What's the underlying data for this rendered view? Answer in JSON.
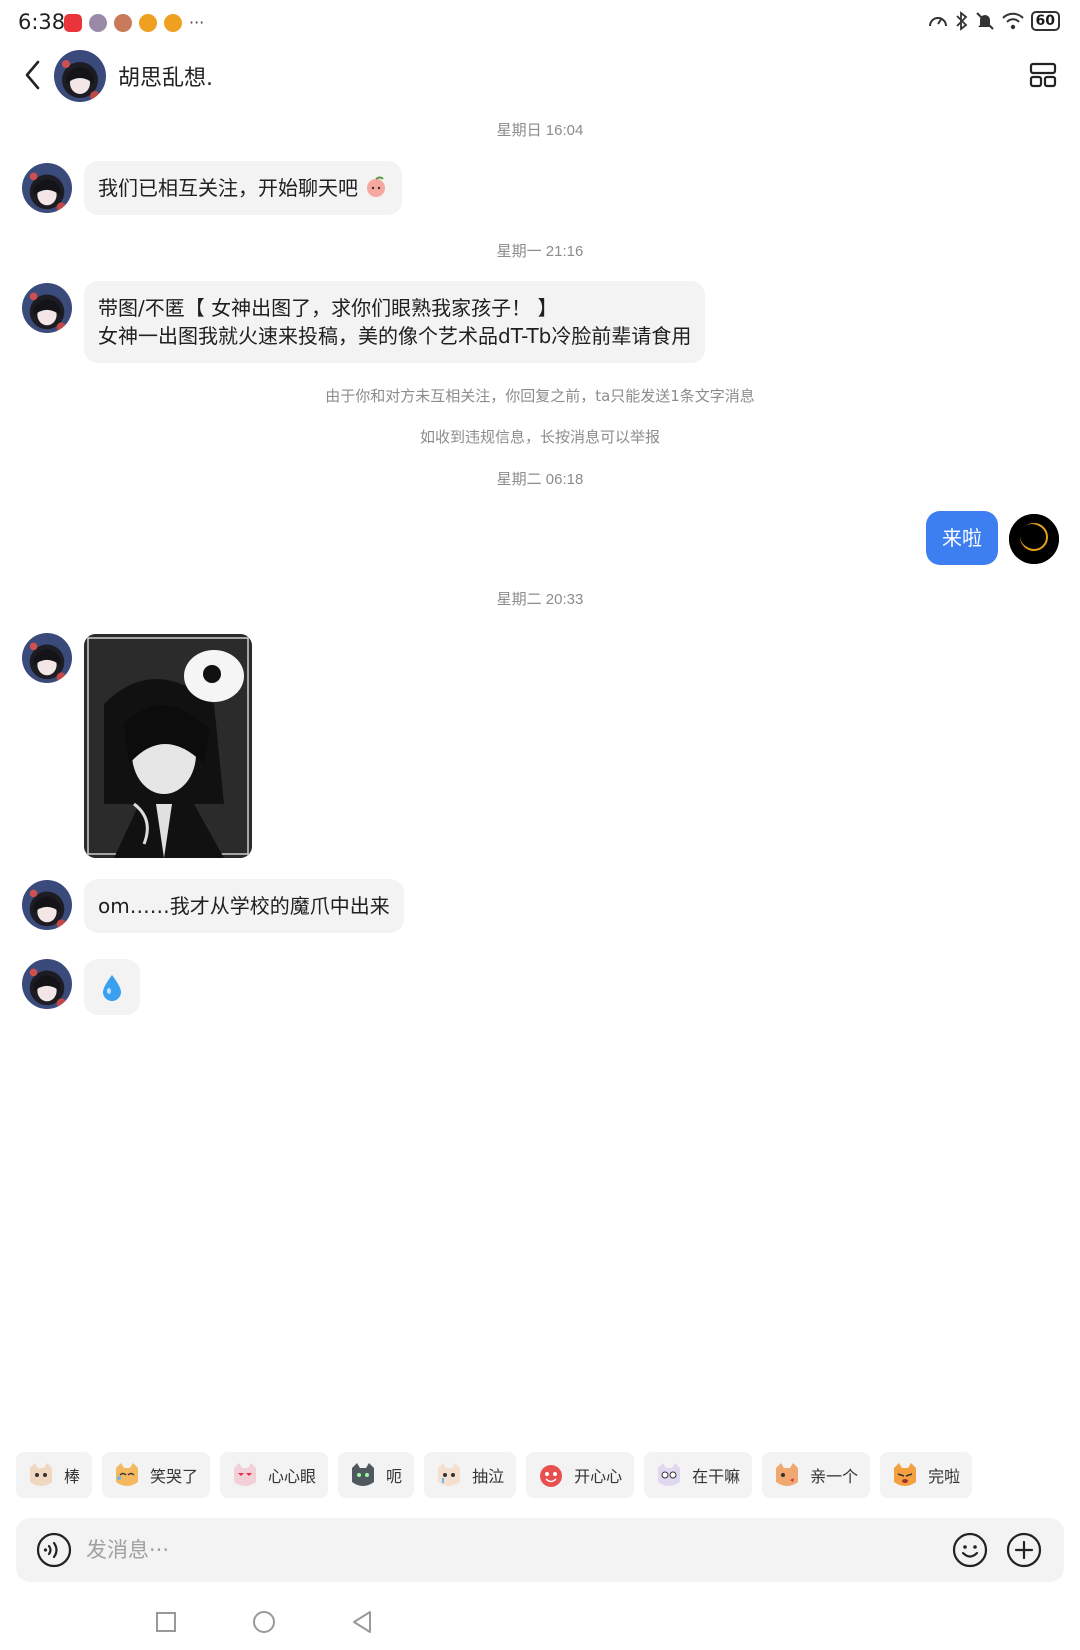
{
  "status_bar": {
    "time": "6:38",
    "more_glyph": "···",
    "battery": "60",
    "icons": [
      "speed-icon",
      "bluetooth-icon",
      "mute-icon",
      "wifi-icon",
      "battery-icon"
    ]
  },
  "header": {
    "contact_name": "胡思乱想."
  },
  "messages": {
    "ts1": "星期日 16:04",
    "m1": "我们已相互关注，开始聊天吧",
    "ts2": "星期一 21:16",
    "m2_line1": "带图/不匿【 女神出图了，求你们眼熟我家孩子！ 】",
    "m2_line2": "女神一出图我就火速来投稿，美的像个艺术品dT-Tb冷脸前辈请食用",
    "sys1": "由于你和对方未互相关注，你回复之前，ta只能发送1条文字消息",
    "sys2": "如收到违规信息，长按消息可以举报",
    "ts3": "星期二 06:18",
    "me1": "来啦",
    "ts4": "星期二 20:33",
    "m4": "om……我才从学校的魔爪中出来"
  },
  "stickers": [
    {
      "label": "棒"
    },
    {
      "label": "笑哭了"
    },
    {
      "label": "心心眼"
    },
    {
      "label": "呃"
    },
    {
      "label": "抽泣"
    },
    {
      "label": "开心心"
    },
    {
      "label": "在干嘛"
    },
    {
      "label": "亲一个"
    },
    {
      "label": "完啦"
    }
  ],
  "input": {
    "placeholder": "发消息···"
  },
  "colors": {
    "accent": "#3d7ff1",
    "bubble_bg": "#f3f3f3",
    "timestamp": "#8c8c8c"
  }
}
